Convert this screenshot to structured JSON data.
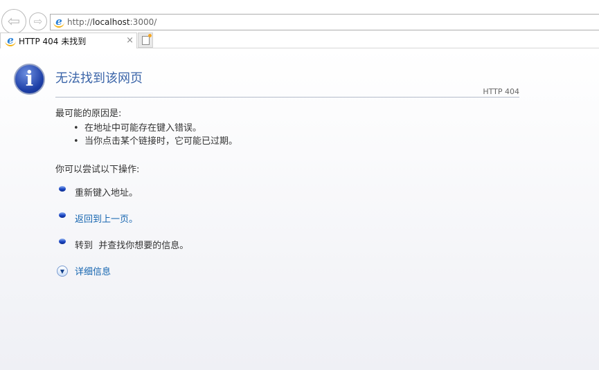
{
  "browser": {
    "address": {
      "host_prefix": "http://",
      "host": "localhost",
      "rest": ":3000/"
    },
    "tab_title": "HTTP 404 未找到",
    "close_glyph": "×"
  },
  "page": {
    "title": "无法找到该网页",
    "code": "HTTP 404",
    "causes_heading": "最可能的原因是:",
    "causes": [
      "在地址中可能存在键入错误。",
      "当你点击某个链接时，它可能已过期。"
    ],
    "actions_heading": "你可以尝试以下操作:",
    "actions": [
      "重新键入地址。",
      "返回到上一页。",
      "转到  并查找你想要的信息。"
    ],
    "more_info": "详细信息"
  }
}
